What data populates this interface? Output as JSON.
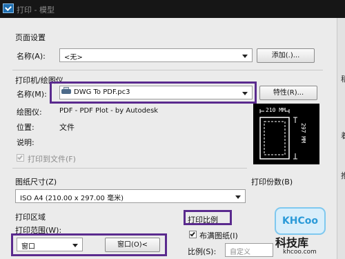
{
  "window": {
    "title": "打印 - 模型"
  },
  "page_setup": {
    "heading": "页面设置",
    "name_label": "名称(A):",
    "name_value": "<无>",
    "add_button": "添加(.)..."
  },
  "printer": {
    "heading": "打印机/绘图仪",
    "name_label": "名称(M):",
    "name_value": "DWG To PDF.pc3",
    "properties_button": "特性(R)...",
    "plotter_label": "绘图仪:",
    "plotter_value": "PDF - PDF Plot - by Autodesk",
    "location_label": "位置:",
    "location_value": "文件",
    "description_label": "说明:",
    "print_to_file_label": "打印到文件(F)",
    "print_to_file_checked": true,
    "preview_width": "210 MM",
    "preview_height": "297 MM"
  },
  "paper_size": {
    "heading": "图纸尺寸(Z)",
    "value": "ISO A4 (210.00 x 297.00 毫米)"
  },
  "copies": {
    "heading": "打印份数(B)"
  },
  "plot_area": {
    "heading": "打印区域",
    "range_label": "打印范围(W):",
    "range_value": "窗口",
    "window_button": "窗口(O)<"
  },
  "plot_scale": {
    "heading": "打印比例",
    "fit_label": "布满图纸(I)",
    "fit_checked": true,
    "scale_label": "比例(S):",
    "scale_value": "自定义"
  },
  "watermark": {
    "badge": "KHCoo",
    "cn": "科技库",
    "url": "khcoo.com"
  },
  "colors": {
    "highlight": "#5a2a8e",
    "dialog_bg": "#ebebeb"
  }
}
